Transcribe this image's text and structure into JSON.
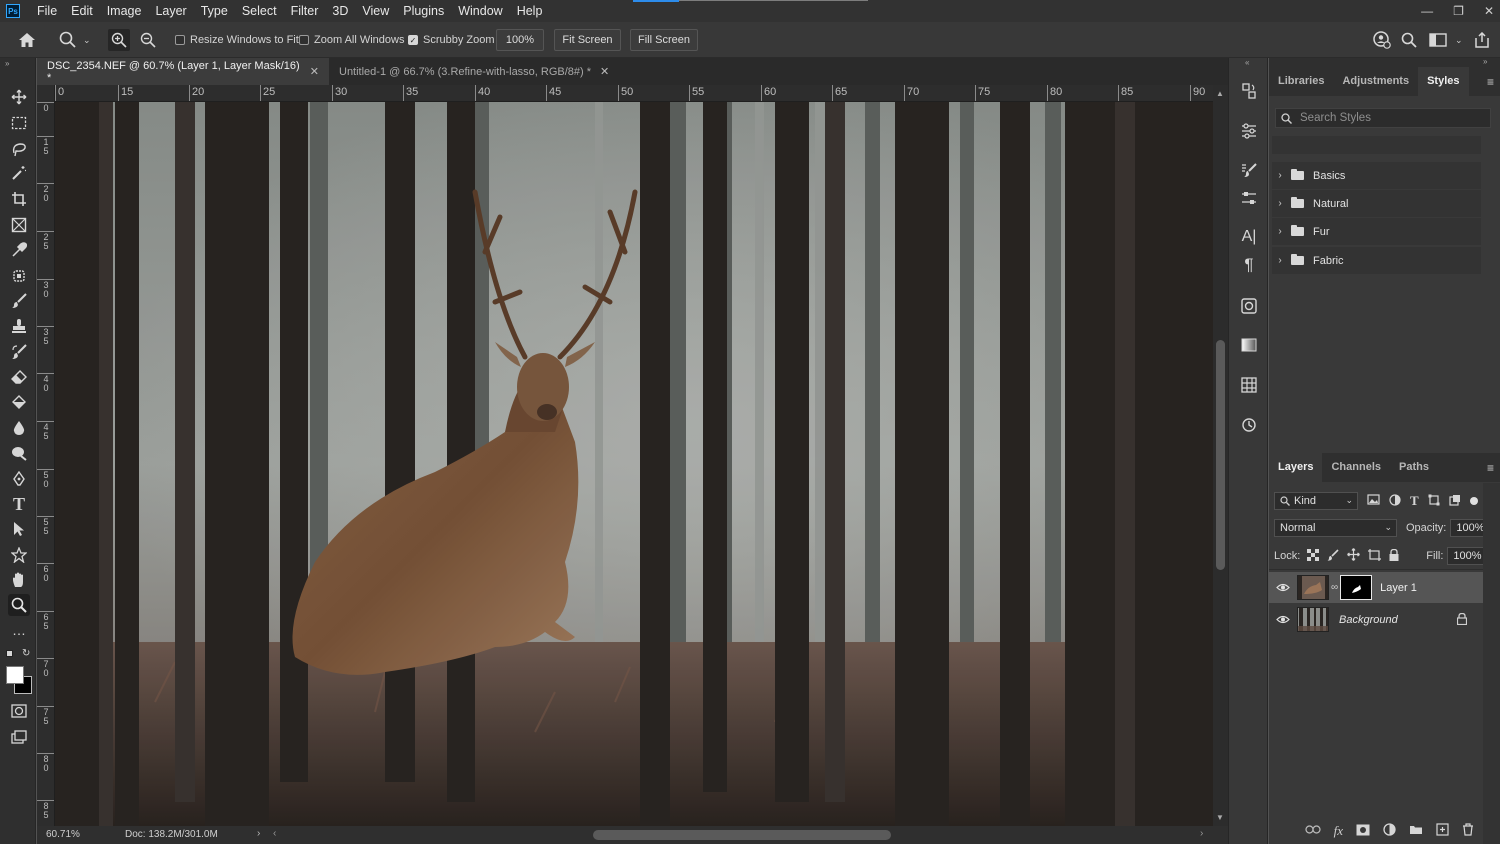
{
  "menubar": {
    "logo": "Ps",
    "items": [
      "File",
      "Edit",
      "Image",
      "Layer",
      "Type",
      "Select",
      "Filter",
      "3D",
      "View",
      "Plugins",
      "Window",
      "Help"
    ]
  },
  "options": {
    "resize_windows": "Resize Windows to Fit",
    "zoom_all": "Zoom All Windows",
    "scrubby_zoom": "Scrubby Zoom",
    "zoom_value": "100%",
    "fit_screen": "Fit Screen",
    "fill_screen": "Fill Screen",
    "resize_checked": false,
    "zoom_all_checked": false,
    "scrubby_checked": true
  },
  "tabs": [
    {
      "label": "DSC_2354.NEF @ 60.7% (Layer 1, Layer Mask/16) *",
      "active": true
    },
    {
      "label": "Untitled-1 @ 66.7% (3.Refine-with-lasso, RGB/8#) *",
      "active": false
    }
  ],
  "rulers": {
    "top": [
      "0",
      "15",
      "20",
      "25",
      "30",
      "35",
      "40",
      "45",
      "50",
      "55",
      "60",
      "65",
      "70",
      "75",
      "80",
      "85",
      "90"
    ],
    "left": [
      "0",
      "1\n5",
      "2\n0",
      "2\n5",
      "3\n0",
      "3\n5",
      "4\n0",
      "4\n5",
      "5\n0",
      "5\n5",
      "6\n0",
      "6\n5",
      "7\n0",
      "7\n5",
      "8\n0",
      "8\n5"
    ]
  },
  "status": {
    "zoom": "60.71%",
    "doc": "Doc: 138.2M/301.0M"
  },
  "styles_panel": {
    "tabs": [
      "Libraries",
      "Adjustments",
      "Styles"
    ],
    "search_placeholder": "Search Styles",
    "folders": [
      "Basics",
      "Natural",
      "Fur",
      "Fabric"
    ]
  },
  "layers_panel": {
    "tabs": [
      "Layers",
      "Channels",
      "Paths"
    ],
    "kind": "Kind",
    "blend_mode": "Normal",
    "opacity_label": "Opacity:",
    "opacity_value": "100%",
    "lock_label": "Lock:",
    "fill_label": "Fill:",
    "fill_value": "100%",
    "layers": [
      {
        "name": "Layer 1",
        "selected": true
      },
      {
        "name": "Background",
        "selected": false
      }
    ]
  },
  "colors": {
    "accent": "#2d8ceb",
    "panel_bg": "#393939",
    "toolbar_bg": "#2f2f2f"
  }
}
